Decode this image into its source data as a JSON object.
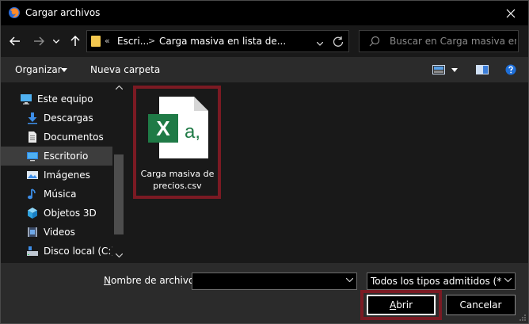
{
  "window": {
    "title": "Cargar archivos"
  },
  "address": {
    "overflow": "«",
    "crumbs": [
      "Escri...",
      "Carga masiva en lista de..."
    ]
  },
  "search": {
    "placeholder": "Buscar en Carga masiva en li..."
  },
  "toolbar": {
    "organize_label": "Organizar",
    "new_folder_label": "Nueva carpeta"
  },
  "sidebar": {
    "items": [
      {
        "label": "Este equipo",
        "icon": "computer-icon"
      },
      {
        "label": "Descargas",
        "icon": "download-icon"
      },
      {
        "label": "Documentos",
        "icon": "document-icon"
      },
      {
        "label": "Escritorio",
        "icon": "desktop-icon",
        "selected": true
      },
      {
        "label": "Imágenes",
        "icon": "pictures-icon"
      },
      {
        "label": "Música",
        "icon": "music-icon"
      },
      {
        "label": "Objetos 3D",
        "icon": "3d-objects-icon"
      },
      {
        "label": "Videos",
        "icon": "video-icon"
      },
      {
        "label": "Disco local (C:)",
        "icon": "drive-icon"
      }
    ]
  },
  "files": [
    {
      "name": "Carga masiva de precios.csv",
      "icon": "excel-csv-icon"
    }
  ],
  "bottom": {
    "filename_label_accel": "N",
    "filename_label_rest": "ombre de archivo:",
    "filename_value": "",
    "filetype_value": "Todos los tipos admitidos (*.csv",
    "open_accel": "A",
    "open_rest": "brir",
    "cancel_label": "Cancelar"
  },
  "colors": {
    "highlight": "#7b1a23",
    "excel_green": "#1f7a46",
    "selected_bg": "#3d3d3d"
  }
}
